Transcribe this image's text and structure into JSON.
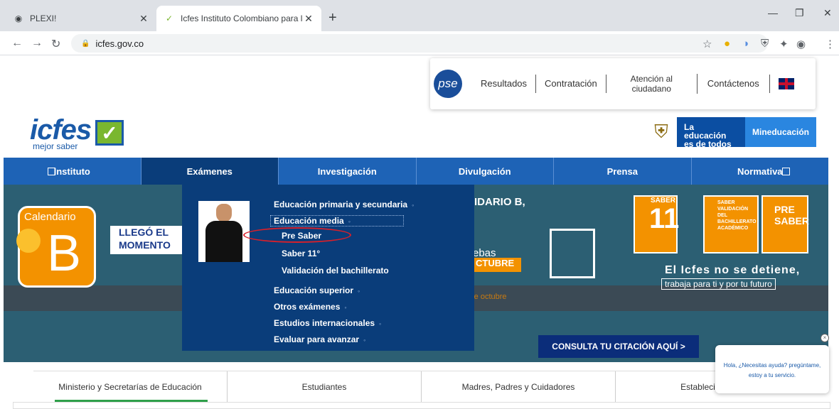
{
  "browser": {
    "tabs": [
      {
        "title": "PLEXI!",
        "icon": "globe-icon"
      },
      {
        "title": "Icfes Instituto Colombiano para la",
        "icon": "icfes-check-icon"
      }
    ],
    "url": "icfes.gov.co"
  },
  "header": {
    "pse": "pse",
    "links": [
      "Resultados",
      "Contratación",
      "Atención al ciudadano",
      "Contáctenos"
    ],
    "logo_text": "icfes",
    "logo_sub": "mejor saber",
    "gov_education": "La educación es de todos",
    "gov_ministry": "Mineducación"
  },
  "nav": {
    "items": [
      "Instituto",
      "Exámenes",
      "Investigación",
      "Divulgación",
      "Prensa",
      "Normativa"
    ]
  },
  "dropdown": {
    "items": [
      {
        "label": "Educación primaria y secundaria",
        "dot": "◦"
      },
      {
        "label": "Educación media",
        "dot": "◦"
      },
      {
        "label": "Pre Saber"
      },
      {
        "label": "Saber 11°"
      },
      {
        "label": "Validación del bachillerato"
      },
      {
        "label": "Educación superior",
        "dot": "◦"
      },
      {
        "label": "Otros exámenes",
        "dot": "◦"
      },
      {
        "label": "Estudios internacionales",
        "dot": "◦"
      },
      {
        "label": "Evaluar para avanzar",
        "dot": "◦"
      }
    ]
  },
  "hero": {
    "calendario": "Calendario",
    "b": "B",
    "llego": [
      "LLEGÓ EL",
      "MOMENTO"
    ],
    "idario": "IDARIO B,",
    "ebas": "ebas",
    "ctubre": "CTUBRE",
    "re_octubre": "re octubre",
    "saber_big": "SABER",
    "saber_11": "11",
    "validacion": "SABER VALIDACIÓN DEL BACHILLERATO ACADÉMICO",
    "pre_saber": "PRE SABER",
    "pruebas": "Pruebas",
    "nodetiene": "El Icfes no se detiene,",
    "trabaja": "trabaja para ti y por tu futuro",
    "cta": "CONSULTA TU CITACIÓN AQUÍ >"
  },
  "bottom_tabs": [
    "Ministerio y Secretarías de Educación",
    "Estudiantes",
    "Madres, Padres y Cuidadores",
    "Establecimientos"
  ],
  "chat": {
    "line1": "Hola, ¿Necesitas ayuda? pregúntame,",
    "line2": "estoy a tu servicio."
  }
}
